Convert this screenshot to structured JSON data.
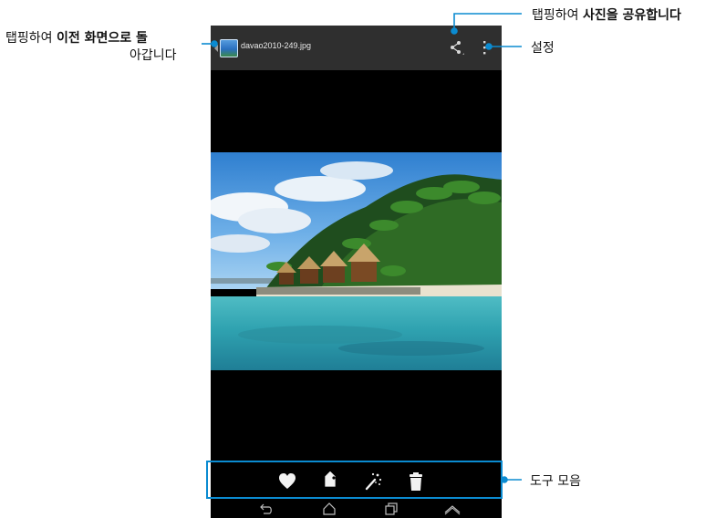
{
  "action_bar": {
    "file_name": "davao2010-249.jpg",
    "share_icon": "share-icon",
    "menu_icon": "overflow-menu-icon"
  },
  "photo": {
    "subject": "beach-with-palm-huts-icon"
  },
  "toolbar": {
    "tools": [
      {
        "name": "favorite-icon"
      },
      {
        "name": "tag-icon"
      },
      {
        "name": "magic-wand-icon"
      },
      {
        "name": "trash-icon"
      }
    ]
  },
  "navbar": {
    "buttons": [
      "back-icon",
      "home-icon",
      "recent-apps-icon",
      "menu-up-icon"
    ]
  },
  "callouts": {
    "back_prefix": "탭핑하여 ",
    "back_bold": "이전 화면으로 돌",
    "back_line2": "아갑니다",
    "share_prefix": "탭핑하여 ",
    "share_bold": "사진을 공유합니다",
    "settings": "설정",
    "toolbar": "도구 모음"
  },
  "colors": {
    "accent": "#0b8bd1",
    "action_bar": "#2f2f2f",
    "screen_bg": "#000000"
  }
}
